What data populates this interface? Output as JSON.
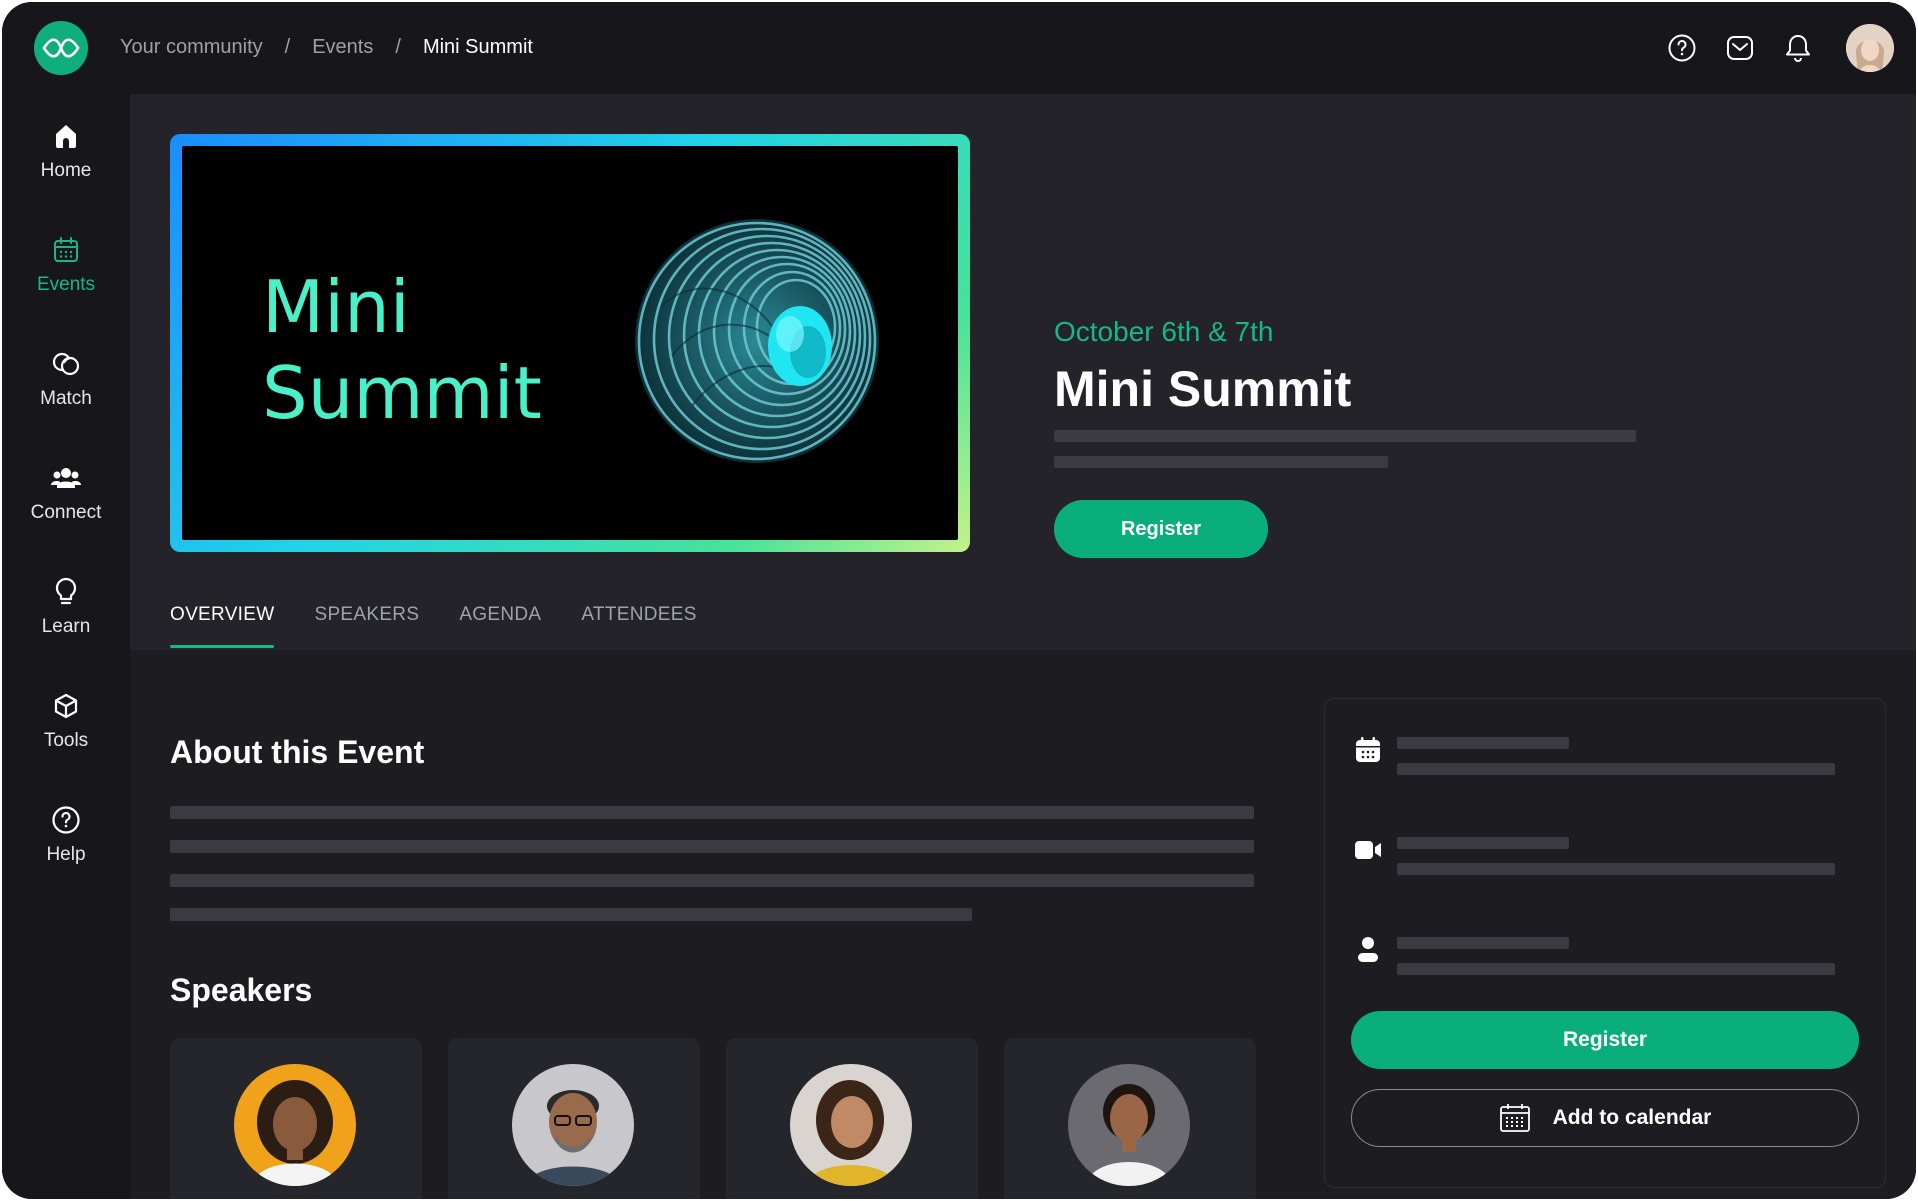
{
  "breadcrumb": {
    "items": [
      "Your community",
      "Events"
    ],
    "current": "Mini Summit"
  },
  "icons": {
    "help": "help-circle-icon",
    "messages": "envelope-icon",
    "notifications": "bell-icon"
  },
  "sidebar": {
    "items": [
      {
        "label": "Home",
        "icon": "home-icon"
      },
      {
        "label": "Events",
        "icon": "calendar-icon",
        "active": true
      },
      {
        "label": "Match",
        "icon": "match-icon"
      },
      {
        "label": "Connect",
        "icon": "people-icon"
      },
      {
        "label": "Learn",
        "icon": "lightbulb-icon"
      },
      {
        "label": "Tools",
        "icon": "cube-icon"
      },
      {
        "label": "Help",
        "icon": "help-circle-icon"
      }
    ]
  },
  "banner": {
    "line1": "Mini",
    "line2": "Summit"
  },
  "event": {
    "date": "October 6th & 7th",
    "title": "Mini Summit",
    "register_label": "Register"
  },
  "tabs": [
    "OVERVIEW",
    "SPEAKERS",
    "AGENDA",
    "ATTENDEES"
  ],
  "overview": {
    "about_title": "About this Event",
    "speakers_title": "Speakers"
  },
  "info_card": {
    "register_label": "Register",
    "calendar_label": "Add to calendar"
  },
  "colors": {
    "accent": "#0aae7b",
    "accent_text": "#17b884",
    "background": "#17171b",
    "panel": "#232329"
  }
}
